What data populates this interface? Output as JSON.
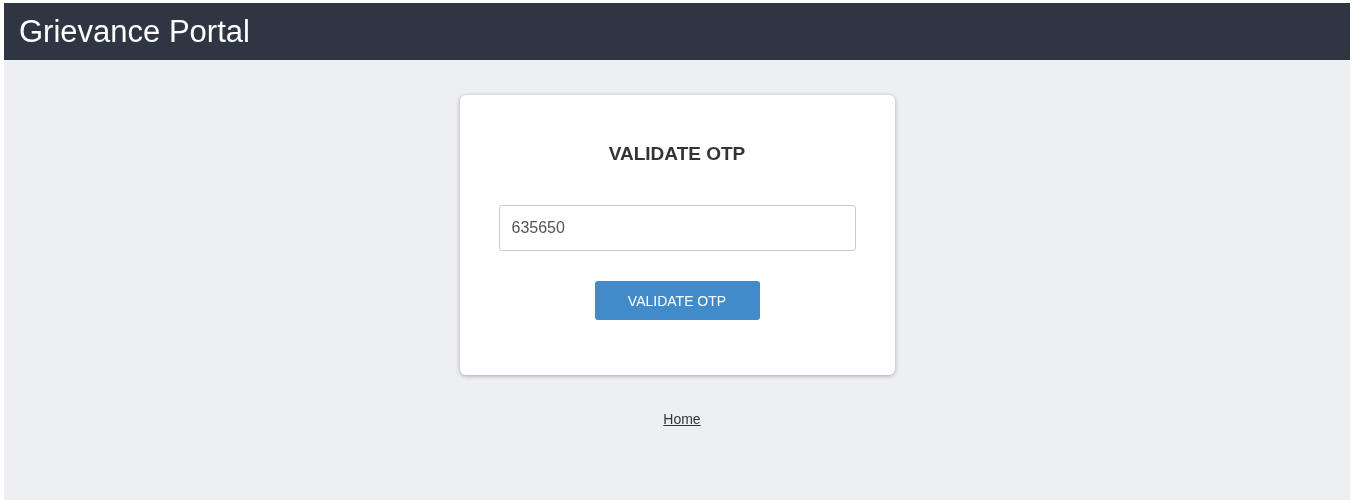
{
  "header": {
    "title": "Grievance Portal"
  },
  "card": {
    "title": "VALIDATE OTP",
    "otp_field": {
      "value": "635650"
    },
    "button": "VALIDATE OTP"
  },
  "footer_link": "Home"
}
